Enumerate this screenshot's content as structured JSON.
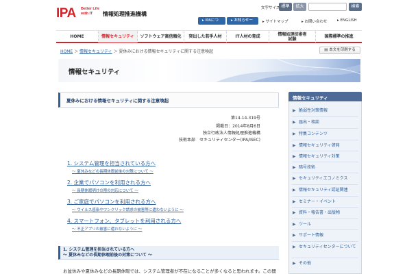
{
  "header": {
    "logo": "IPA",
    "logo_tagline_1": "Better Life",
    "logo_tagline_2": "with IT",
    "org_name": "情報処理推進機構",
    "font_size_label": "文字サイズ",
    "font_size_standard": "標準",
    "font_size_large": "拡大",
    "search_button": "検索"
  },
  "utility_nav": {
    "about_ipa": "IPAについて",
    "news": "お知らせ一覧",
    "sitemap": "サイトマップ",
    "contact": "お問い合わせ",
    "english": "ENGLISH"
  },
  "main_nav": [
    {
      "label": "HOME"
    },
    {
      "label": "情報セキュリティ"
    },
    {
      "label": "ソフトウェア高信頼化"
    },
    {
      "label": "突出した若手人材"
    },
    {
      "label": "IT人材の育成"
    },
    {
      "label": "情報処理技術者試験"
    },
    {
      "label": "国際標準の推進"
    }
  ],
  "breadcrumb": {
    "home": "HOME",
    "section": "情報セキュリティ",
    "current": "夏休みにおける情報セキュリティに関する注意喚起",
    "print": "本文を印刷する"
  },
  "banner": {
    "title": "情報セキュリティ"
  },
  "article": {
    "title": "夏休みにおける情報セキュリティに関する注意喚起",
    "number": "第14-14-319号",
    "date": "掲載日：2014年8月6日",
    "org": "独立行政法人情報処理推進機構",
    "dept": "技術本部　セキュリティセンター(IPA/ISEC)",
    "toc": [
      {
        "title": "1.  システム管理を担当されている方へ",
        "sub": "～ 夏休みなどの長期休暇前後の対策について ～"
      },
      {
        "title": "2.  企業でパソコンを利用される方へ",
        "sub": "～ 長期休暇明けの際の対応について ～"
      },
      {
        "title": "3.  ご家庭でパソコンを利用される方へ",
        "sub": "～ ウイルス感染やワンクリック請求の被害等に遭わないように ～"
      },
      {
        "title": "4.  スマートフォン、タブレットを利用される方へ",
        "sub": "～ 不正アプリの被害に遭わないように ～"
      }
    ],
    "section1_title": "1.  システム管理を担当されている方へ",
    "section1_sub": "～ 夏休みなどの長期休暇前後の対策について ～",
    "body_start": "お盆休みや夏休みなどの長期休暇では、システム管理者が不在になることが多くなると思われます。この間"
  },
  "sidebar": {
    "heading": "情報セキュリティ",
    "items": [
      "脆弱性対策情報",
      "届出・相談",
      "特集コンテンツ",
      "情報セキュリティ啓発",
      "情報セキュリティ対策",
      "暗号技術",
      "セキュリティエコノミクス",
      "情報セキュリティ認証関連",
      "セミナー・イベント",
      "資料・報告書・出版物",
      "ツール",
      "サポート情報",
      "セキュリティセンターについて",
      "その他"
    ]
  },
  "colors": {
    "brand_red": "#d2232a",
    "link_blue": "#2d5f9c",
    "sidebar_head": "#4d6b96"
  }
}
